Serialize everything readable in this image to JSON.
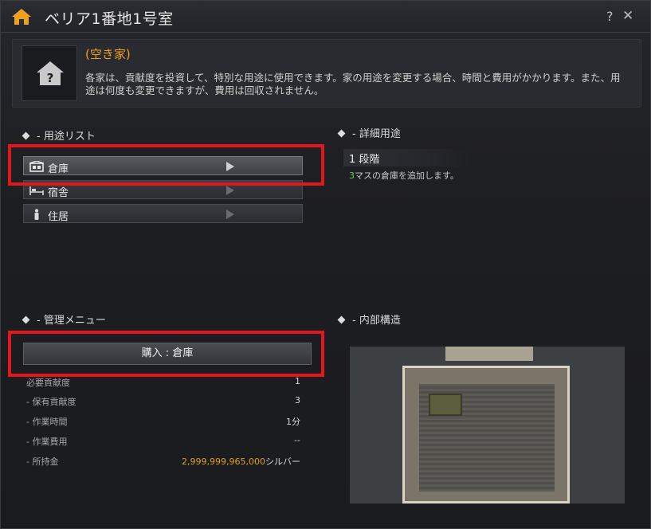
{
  "window": {
    "title": "ベリア1番地1号室",
    "help_label": "?",
    "close_label": "✕"
  },
  "header": {
    "status": "(空き家)",
    "description": "各家は、貢献度を投資して、特別な用途に使用できます。家の用途を変更する場合、時間と費用がかかります。また、用途は何度も変更できますが、費用は回収されません。"
  },
  "usage_list": {
    "title": "- 用途リスト",
    "items": [
      {
        "label": "倉庫",
        "icon": "storage-icon",
        "selected": true
      },
      {
        "label": "宿舎",
        "icon": "bed-icon",
        "selected": false
      },
      {
        "label": "住居",
        "icon": "person-icon",
        "selected": false
      }
    ]
  },
  "detail": {
    "title": "- 詳細用途",
    "level": "1 段階",
    "desc_num": "3",
    "desc_text": "マスの倉庫を追加します。"
  },
  "management": {
    "title": "- 管理メニュー",
    "buy_label": "購入 : 倉庫",
    "rows": [
      {
        "label": "必要貢献度",
        "value": "1"
      },
      {
        "label": "- 保有貢献度",
        "value": "3"
      },
      {
        "label": "- 作業時間",
        "value": "1分"
      },
      {
        "label": "- 作業費用",
        "value": "--"
      },
      {
        "label": "- 所持金",
        "amount": "2,999,999,965,000",
        "unit": "シルバー"
      }
    ]
  },
  "structure": {
    "title": "- 内部構造"
  },
  "colors": {
    "highlight": "#e0181e",
    "gold": "#f0a020",
    "green": "#7fc44a"
  }
}
